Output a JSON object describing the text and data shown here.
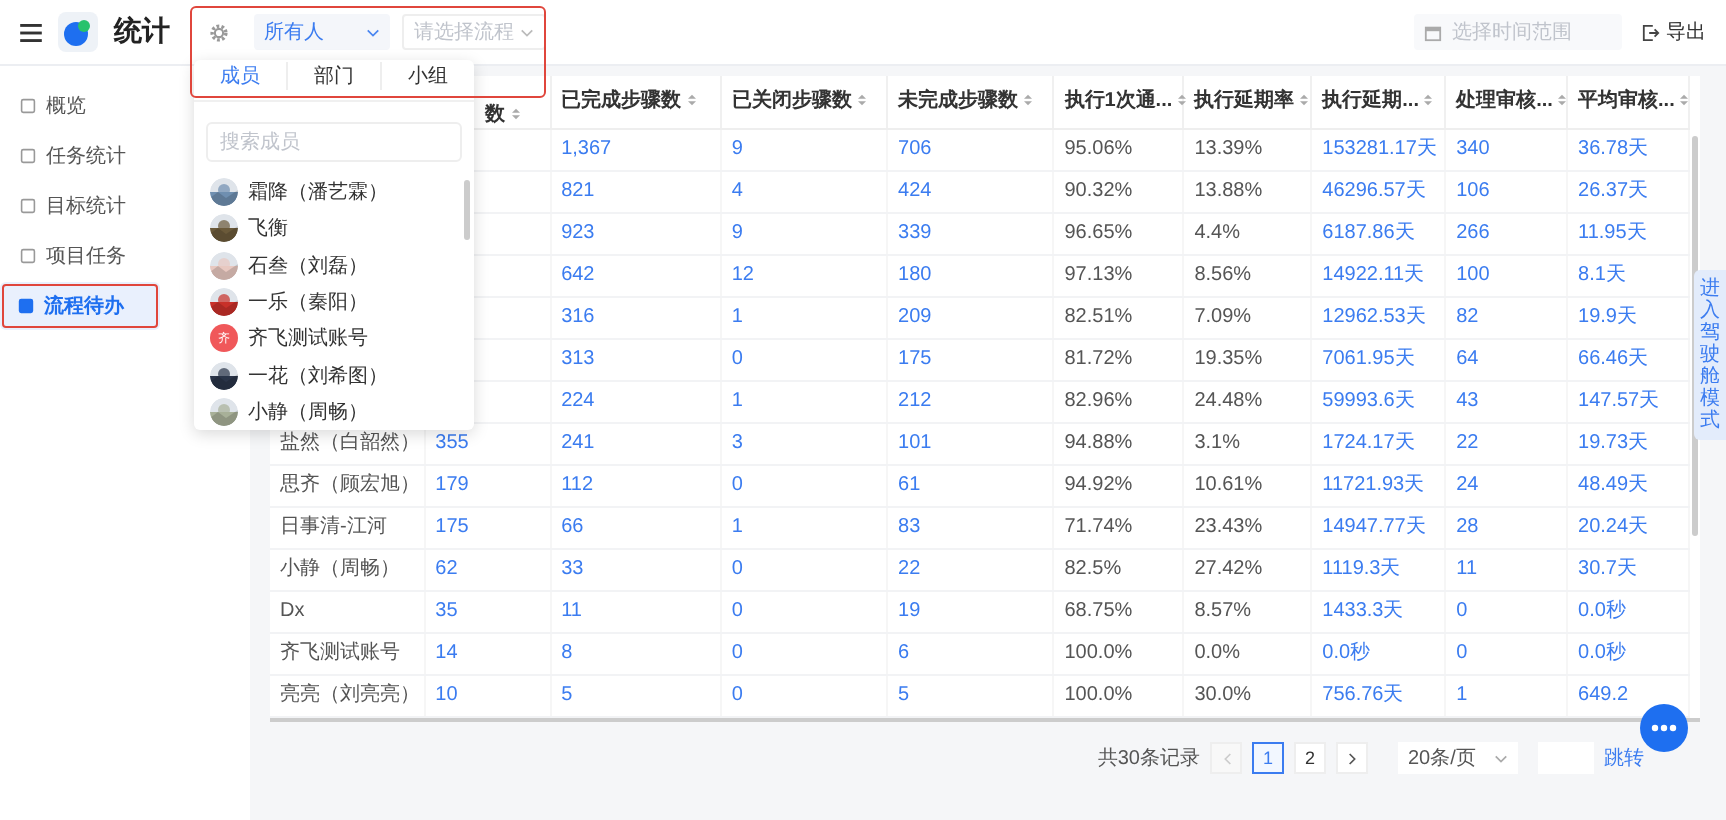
{
  "app": {
    "title": "统计"
  },
  "sidebar": {
    "items": [
      {
        "label": "概览",
        "selected": false,
        "highlighted": false
      },
      {
        "label": "任务统计",
        "selected": false,
        "highlighted": false
      },
      {
        "label": "目标统计",
        "selected": false,
        "highlighted": false
      },
      {
        "label": "项目任务",
        "selected": false,
        "highlighted": false
      },
      {
        "label": "流程待办",
        "selected": true,
        "highlighted": true
      }
    ]
  },
  "filters": {
    "highlighted": true,
    "owner": {
      "value": "所有人"
    },
    "process": {
      "placeholder": "请选择流程"
    }
  },
  "member_picker": {
    "tabs": [
      {
        "label": "成员",
        "selected": true
      },
      {
        "label": "部门",
        "selected": false
      },
      {
        "label": "小组",
        "selected": false
      }
    ],
    "search": {
      "placeholder": "搜索成员"
    },
    "members": [
      {
        "name": "霜降（潘艺霖）"
      },
      {
        "name": "飞衡"
      },
      {
        "name": "石叁（刘磊）"
      },
      {
        "name": "一乐（秦阳）"
      },
      {
        "name": "齐飞测试账号",
        "kind": "initial",
        "initial": "齐",
        "color": "#f0585a"
      },
      {
        "name": "一花（刘希图）"
      },
      {
        "name": "小静（周畅）"
      }
    ]
  },
  "date_range": {
    "placeholder": "选择时间范围"
  },
  "export_button": {
    "label": "导出"
  },
  "table": {
    "columns": [
      {
        "label": "数",
        "kind": "link"
      },
      {
        "label": "已完成步骤数",
        "kind": "link"
      },
      {
        "label": "已关闭步骤数",
        "kind": "link"
      },
      {
        "label": "未完成步骤数",
        "kind": "link"
      },
      {
        "label": "执行1次通...",
        "kind": "text"
      },
      {
        "label": "执行延期率",
        "kind": "text"
      },
      {
        "label": "执行延期...",
        "kind": "link"
      },
      {
        "label": "处理审核...",
        "kind": "link"
      },
      {
        "label": "平均审核...",
        "kind": "link"
      }
    ],
    "rows": [
      {
        "values": [
          "1,367",
          "9",
          "706",
          "95.06%",
          "13.39%",
          "153281.17天",
          "340",
          "36.78天"
        ]
      },
      {
        "values": [
          "821",
          "4",
          "424",
          "90.32%",
          "13.88%",
          "46296.57天",
          "106",
          "26.37天"
        ]
      },
      {
        "values": [
          "923",
          "9",
          "339",
          "96.65%",
          "4.4%",
          "6187.86天",
          "266",
          "11.95天"
        ]
      },
      {
        "values": [
          "642",
          "12",
          "180",
          "97.13%",
          "8.56%",
          "14922.11天",
          "100",
          "8.1天"
        ]
      },
      {
        "values": [
          "316",
          "1",
          "209",
          "82.51%",
          "7.09%",
          "12962.53天",
          "82",
          "19.9天"
        ]
      },
      {
        "values": [
          "313",
          "0",
          "175",
          "81.72%",
          "19.35%",
          "7061.95天",
          "64",
          "66.46天"
        ]
      },
      {
        "values": [
          "224",
          "1",
          "212",
          "82.96%",
          "24.48%",
          "59993.6天",
          "43",
          "147.57天"
        ]
      },
      {
        "name": "盐然（白韶然）",
        "total": "355",
        "values": [
          "241",
          "3",
          "101",
          "94.88%",
          "3.1%",
          "1724.17天",
          "22",
          "19.73天"
        ]
      },
      {
        "name": "思齐（顾宏旭）",
        "total": "179",
        "values": [
          "112",
          "0",
          "61",
          "94.92%",
          "10.61%",
          "11721.93天",
          "24",
          "48.49天"
        ]
      },
      {
        "name": "日事清-江河",
        "total": "175",
        "values": [
          "66",
          "1",
          "83",
          "71.74%",
          "23.43%",
          "14947.77天",
          "28",
          "20.24天"
        ]
      },
      {
        "name": "小静（周畅）",
        "total": "62",
        "values": [
          "33",
          "0",
          "22",
          "82.5%",
          "27.42%",
          "1119.3天",
          "11",
          "30.7天"
        ]
      },
      {
        "name": "Dx",
        "total": "35",
        "values": [
          "11",
          "0",
          "19",
          "68.75%",
          "8.57%",
          "1433.3天",
          "0",
          "0.0秒"
        ]
      },
      {
        "name": "齐飞测试账号",
        "total": "14",
        "values": [
          "8",
          "0",
          "6",
          "100.0%",
          "0.0%",
          "0.0秒",
          "0",
          "0.0秒"
        ]
      },
      {
        "name": "亮亮（刘亮亮）",
        "total": "10",
        "values": [
          "5",
          "0",
          "5",
          "100.0%",
          "30.0%",
          "756.76天",
          "1",
          "649.2"
        ]
      }
    ]
  },
  "pagination": {
    "total": "共30条记录",
    "pages": [
      {
        "label": "1",
        "selected": true
      },
      {
        "label": "2",
        "selected": false
      }
    ],
    "prev_disabled": true,
    "page_size": "20条/页",
    "jump": "跳转"
  },
  "side_tab": {
    "label": "进入驾驶舱模式"
  }
}
